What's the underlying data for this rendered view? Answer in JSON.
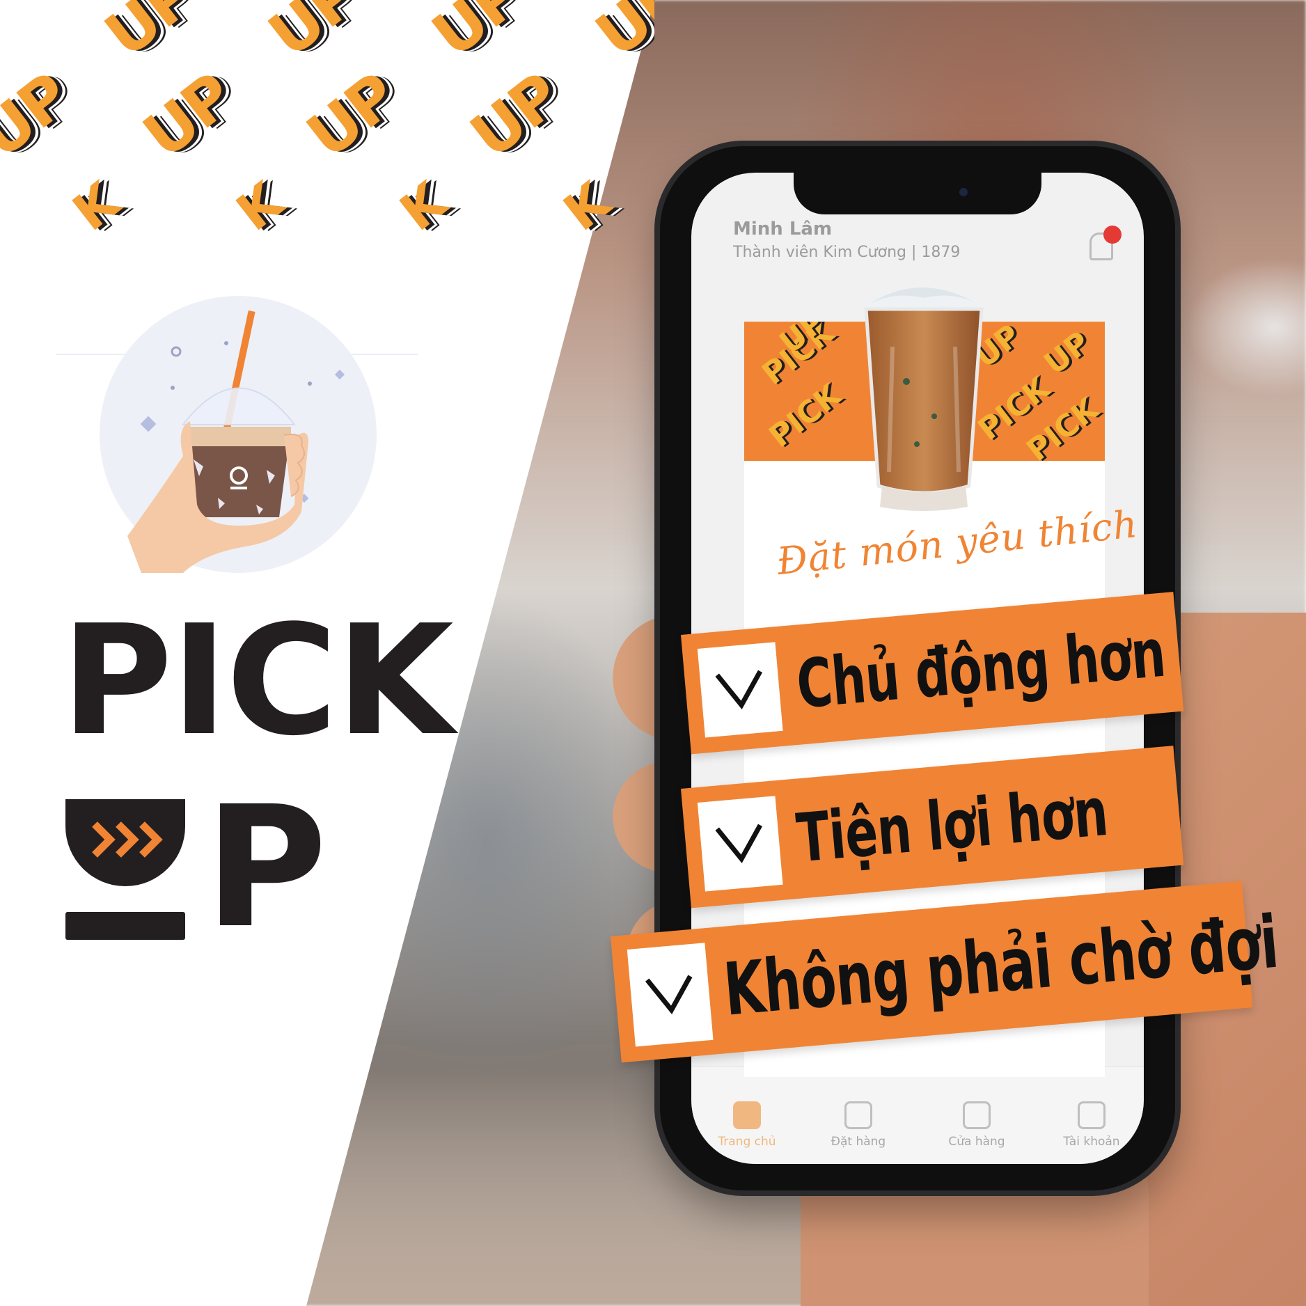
{
  "pattern": {
    "word": "UP",
    "partial": "K"
  },
  "card_pattern": {
    "word1": "PICK",
    "word2": "UP"
  },
  "logo": {
    "line1": "PICK",
    "line2_letter": "P"
  },
  "app": {
    "user_name": "Minh Lâm",
    "member_info": "Thành viên Kim Cương | 1879",
    "tabs": [
      "Trang chủ",
      "Đặt hàng",
      "Cửa hàng",
      "Tài khoản"
    ]
  },
  "card": {
    "script_text": "Đặt món yêu thích"
  },
  "benefits": [
    "Chủ động hơn",
    "Tiện lợi hơn",
    "Không phải chờ đợi"
  ],
  "colors": {
    "brand_orange": "#f08434",
    "pattern_orange": "#f5a033",
    "dark": "#231f20"
  }
}
